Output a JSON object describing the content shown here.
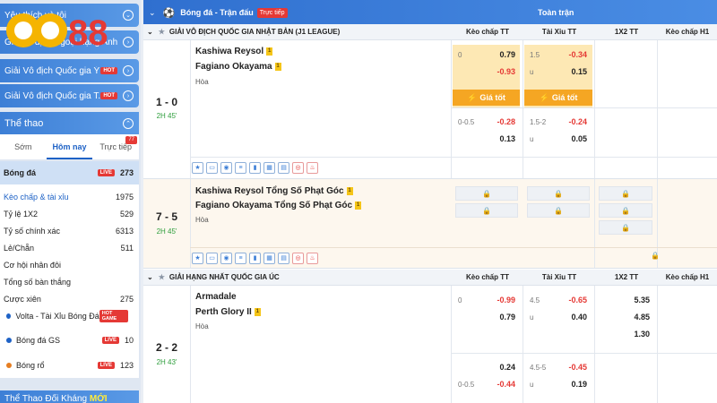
{
  "sidebar": {
    "promos": [
      {
        "label": "Yêu thích và tôi"
      },
      {
        "label": "Giải vô địch Ngoại hạng Anh"
      },
      {
        "label": "Giải Vô địch Quốc gia Ý",
        "badge": "HOT"
      },
      {
        "label": "Giải Vô địch Quốc gia T...",
        "badge": "HOT"
      }
    ],
    "logo_text": "CO88",
    "sport_header": "Thể thao",
    "tabs": [
      {
        "label": "Sớm"
      },
      {
        "label": "Hôm nay"
      },
      {
        "label": "Trực tiếp",
        "badge": "77"
      }
    ],
    "football": {
      "label": "Bóng đá",
      "badge": "LIVE",
      "count": "273"
    },
    "sub_items": [
      {
        "label": "Kèo chấp & tài xỉu",
        "count": "1975"
      },
      {
        "label": "Tỷ lệ 1X2",
        "count": "529"
      },
      {
        "label": "Tỷ số chính xác",
        "count": "6313"
      },
      {
        "label": "Lẻ/Chẵn",
        "count": "511"
      },
      {
        "label": "Cơ hội nhân đôi",
        "count": ""
      },
      {
        "label": "Tổng số bàn thắng",
        "count": ""
      },
      {
        "label": "Cược xiên",
        "count": "275"
      }
    ],
    "others": [
      {
        "label": "Volta - Tài Xỉu Bóng Đá",
        "badge": "HOT GAME",
        "count": ""
      },
      {
        "label": "Bóng đá GS",
        "badge": "LIVE",
        "count": "10"
      },
      {
        "label": "Bóng rổ",
        "badge": "LIVE",
        "count": "123"
      }
    ],
    "bottom_header": "Thể Thao Đối Kháng",
    "bottom_badge": "MỚI"
  },
  "main": {
    "topbar_title": "Bóng đá - Trận đấu",
    "topbar_badge": "Trực tiếp",
    "topbar_full": "Toàn trận",
    "col_handicap": "Kèo chấp TT",
    "col_overunder": "Tài Xỉu TT",
    "col_1x2": "1X2 TT",
    "col_h1": "Kèo chấp H1",
    "good_odds": "Giá tốt",
    "draw_label": "Hòa",
    "league1": "GIẢI VÔ ĐỊCH QUỐC GIA NHẬT BẢN (J1 LEAGUE)",
    "league2": "GIẢI HẠNG NHẤT QUỐC GIA ÚC",
    "m1": {
      "score": "1 - 0",
      "time": "2H 45'",
      "home": "Kashiwa Reysol",
      "home_card": "1",
      "away": "Fagiano Okayama",
      "away_card": "1",
      "r1": {
        "h_lbl": "0",
        "h1": "0.79",
        "h2": "-0.93",
        "o_lbl": "1.5",
        "o1": "-0.34",
        "o_u": "u",
        "o2": "0.15"
      },
      "r2": {
        "h_lbl": "0-0.5",
        "h1": "-0.28",
        "h2": "0.13",
        "o_lbl": "1.5-2",
        "o1": "-0.24",
        "o_u": "u",
        "o2": "0.05"
      }
    },
    "m2": {
      "score": "7 - 5",
      "time": "2H 45'",
      "home": "Kashiwa Reysol Tổng Số Phạt Góc",
      "home_card": "1",
      "away": "Fagiano Okayama Tổng Số Phạt Góc",
      "away_card": "1"
    },
    "m3": {
      "score": "2 - 2",
      "time": "2H 43'",
      "home": "Armadale",
      "away": "Perth Glory II",
      "away_card": "1",
      "r1": {
        "h_lbl": "0",
        "h1": "-0.99",
        "h2": "0.79",
        "o_lbl": "4.5",
        "o1": "-0.65",
        "o_u": "u",
        "o2": "0.40",
        "x1": "5.35",
        "x2": "4.85",
        "x3": "1.30"
      },
      "r2": {
        "h1": "0.24",
        "h_lbl2": "0-0.5",
        "h2": "-0.44",
        "o_lbl": "4.5-5",
        "o1": "-0.45",
        "o_u": "u",
        "o2": "0.19"
      }
    }
  }
}
